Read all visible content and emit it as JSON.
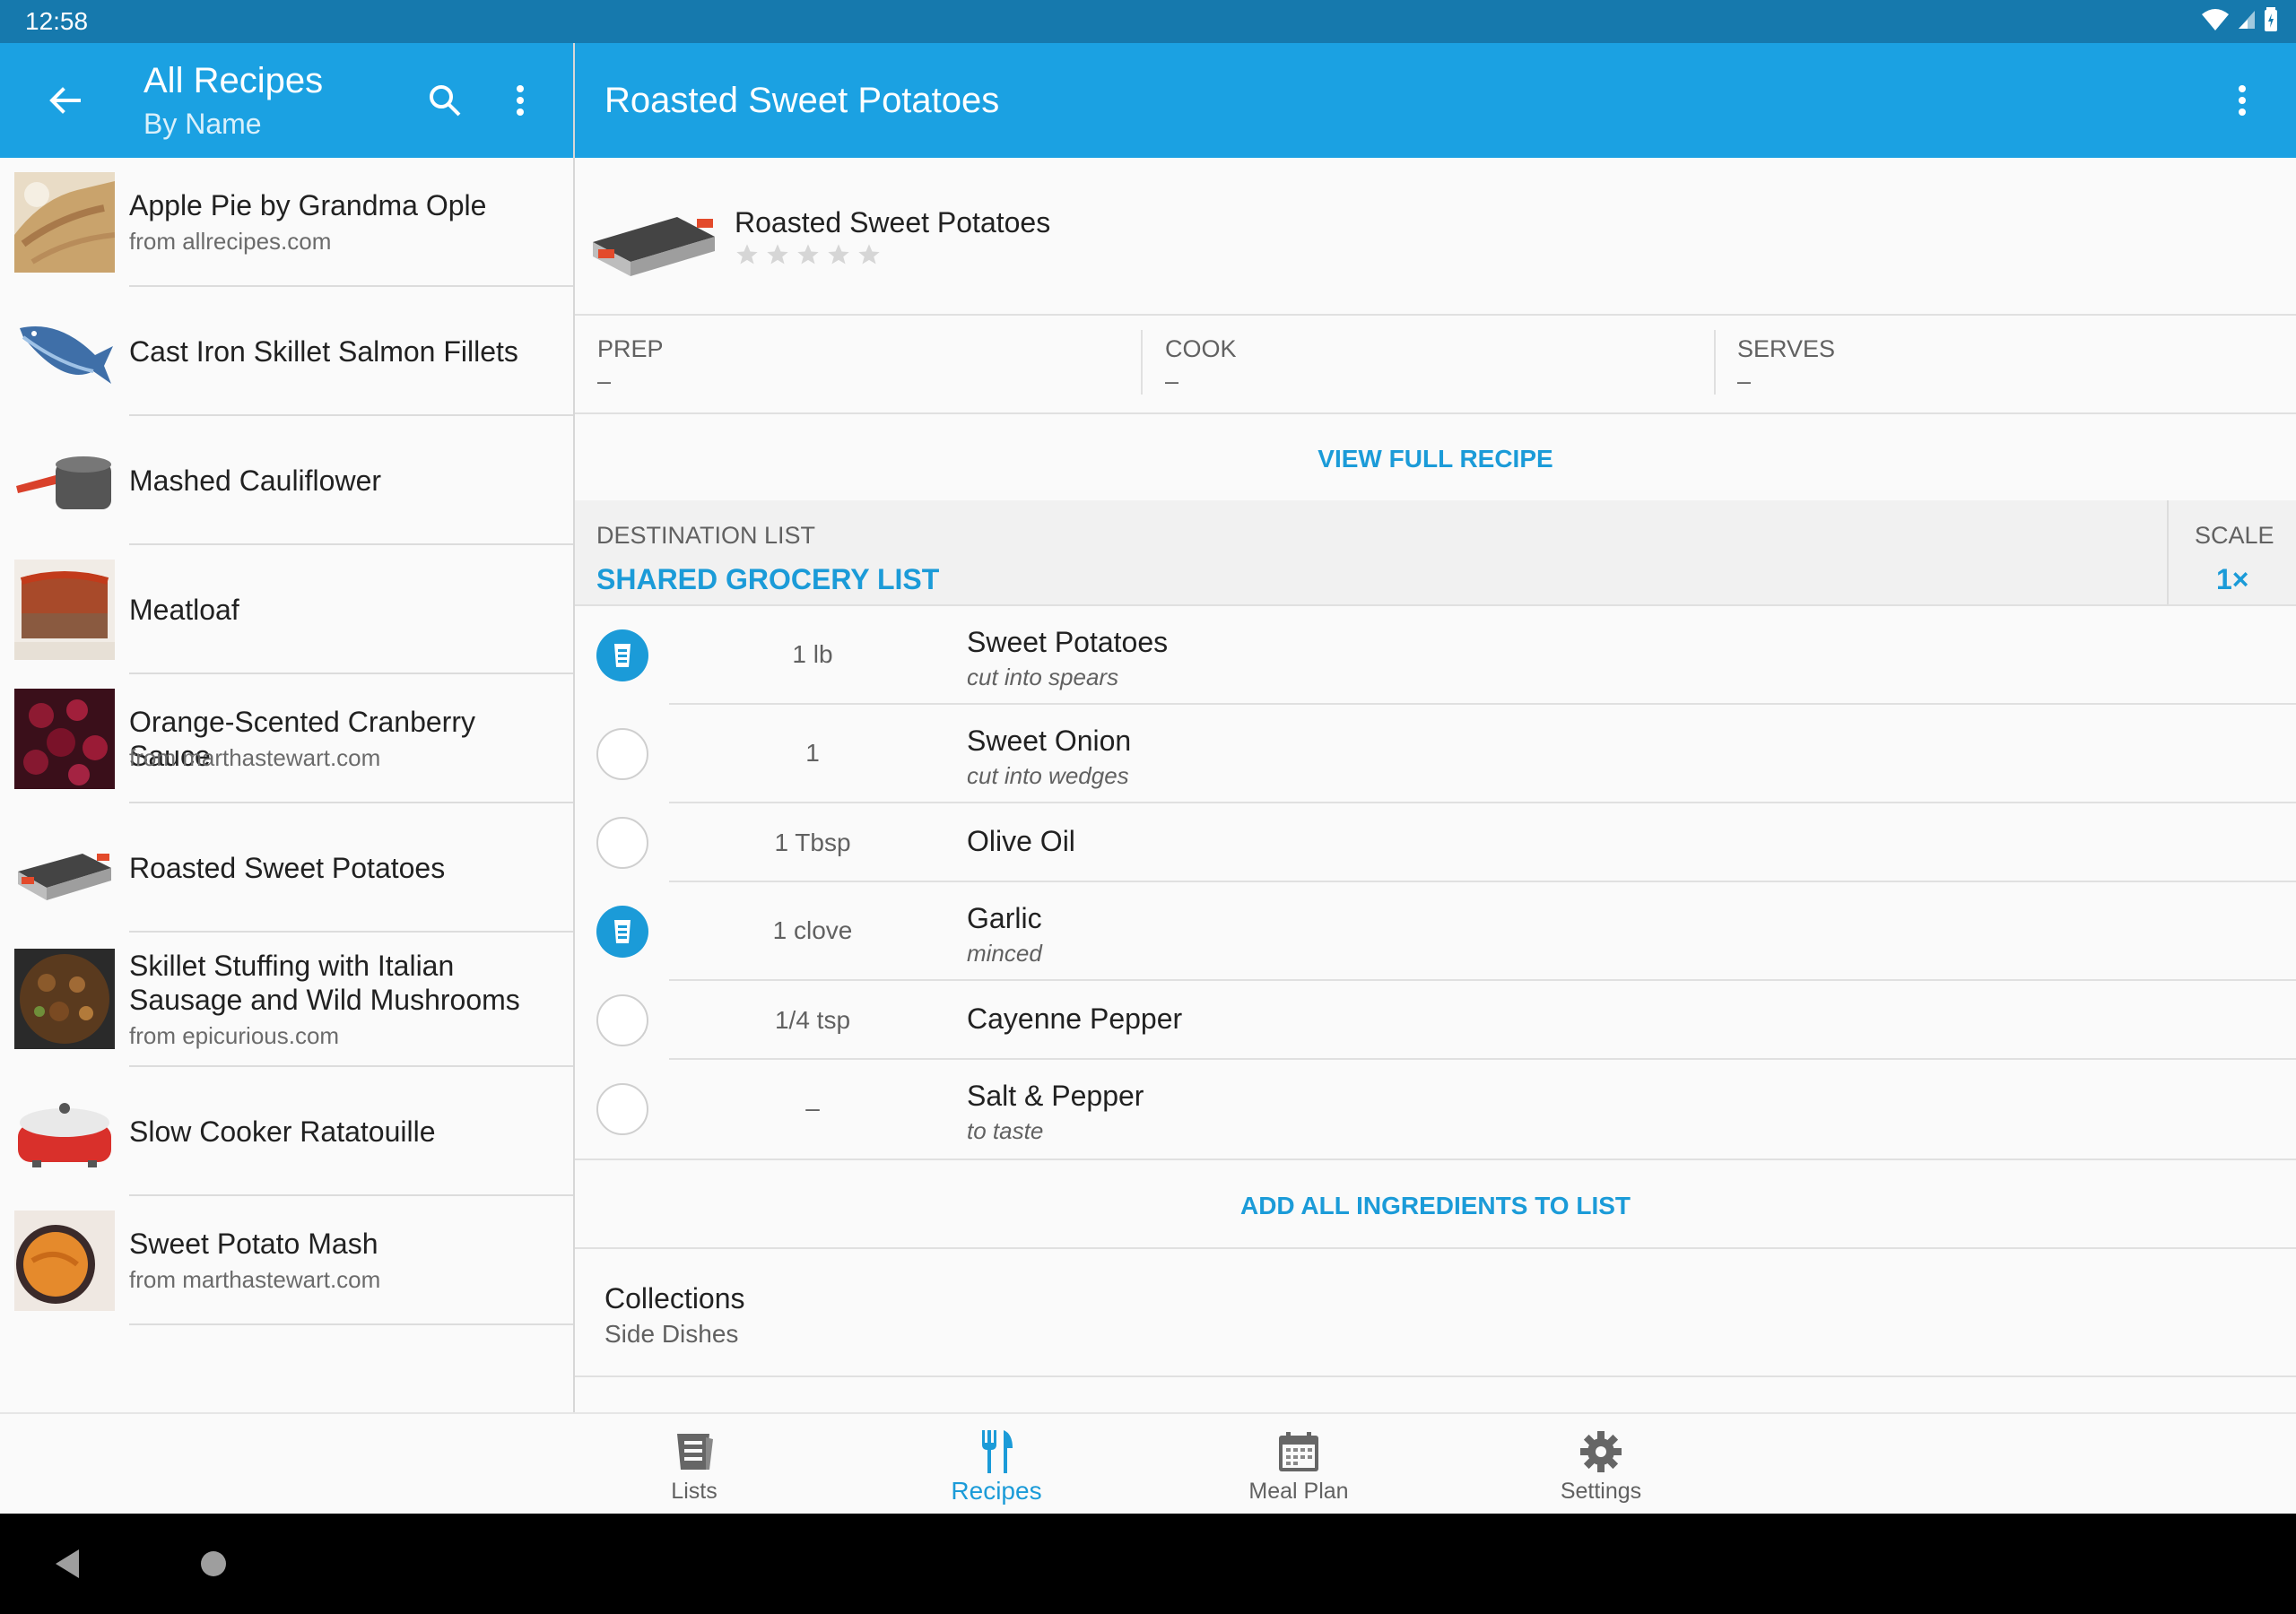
{
  "status_bar": {
    "time": "12:58"
  },
  "left_bar": {
    "title": "All Recipes",
    "subtitle": "By Name"
  },
  "recipes": [
    {
      "name": "Apple Pie by Grandma Ople",
      "source": "from allrecipes.com",
      "thumb": "apple-pie-photo"
    },
    {
      "name": "Cast Iron Skillet Salmon Fillets",
      "source": "",
      "thumb": "fish-icon"
    },
    {
      "name": "Mashed Cauliflower",
      "source": "",
      "thumb": "saucepan-icon"
    },
    {
      "name": "Meatloaf",
      "source": "",
      "thumb": "meatloaf-photo"
    },
    {
      "name": "Orange-Scented Cranberry Sauce",
      "source": "from marthastewart.com",
      "thumb": "cranberry-photo"
    },
    {
      "name": "Roasted Sweet Potatoes",
      "source": "",
      "thumb": "roasting-pan-icon"
    },
    {
      "name": "Skillet Stuffing with Italian Sausage and Wild Mushrooms",
      "source": "from epicurious.com",
      "thumb": "stuffing-photo"
    },
    {
      "name": "Slow Cooker Ratatouille",
      "source": "",
      "thumb": "slow-cooker-icon"
    },
    {
      "name": "Sweet Potato Mash",
      "source": "from marthastewart.com",
      "thumb": "sweet-potato-mash-photo"
    }
  ],
  "detail": {
    "title": "Roasted Sweet Potatoes",
    "header_name": "Roasted Sweet Potatoes",
    "rating": 0,
    "rating_max": 5,
    "prep_label": "PREP",
    "prep_value": "–",
    "cook_label": "COOK",
    "cook_value": "–",
    "serves_label": "SERVES",
    "serves_value": "–",
    "view_full": "VIEW FULL RECIPE",
    "dest_label": "DESTINATION LIST",
    "dest_value": "SHARED GROCERY LIST",
    "scale_label": "SCALE",
    "scale_value": "1×",
    "ingredients": [
      {
        "checked": true,
        "qty": "1 lb",
        "name": "Sweet Potatoes",
        "note": "cut into spears"
      },
      {
        "checked": false,
        "qty": "1",
        "name": "Sweet Onion",
        "note": "cut into wedges"
      },
      {
        "checked": false,
        "qty": "1 Tbsp",
        "name": "Olive Oil",
        "note": ""
      },
      {
        "checked": true,
        "qty": "1 clove",
        "name": "Garlic",
        "note": "minced"
      },
      {
        "checked": false,
        "qty": "1/4 tsp",
        "name": "Cayenne Pepper",
        "note": ""
      },
      {
        "checked": false,
        "qty": "–",
        "name": "Salt & Pepper",
        "note": "to taste"
      }
    ],
    "add_all": "ADD ALL INGREDIENTS TO LIST",
    "collections_label": "Collections",
    "collections_value": "Side Dishes"
  },
  "bottom_nav": [
    {
      "label": "Lists",
      "icon": "list-icon",
      "active": false
    },
    {
      "label": "Recipes",
      "icon": "fork-knife-icon",
      "active": true
    },
    {
      "label": "Meal Plan",
      "icon": "calendar-icon",
      "active": false
    },
    {
      "label": "Settings",
      "icon": "gear-icon",
      "active": false
    }
  ],
  "colors": {
    "app_bar": "#1ba1e2",
    "status_bar": "#1679ad",
    "accent": "#1b9bd8"
  }
}
